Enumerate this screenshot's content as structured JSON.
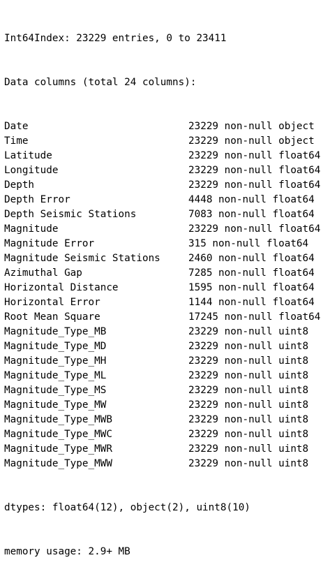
{
  "header": {
    "index_line": "Int64Index: 23229 entries, 0 to 23411",
    "columns_line": "Data columns (total 24 columns):"
  },
  "columns": [
    {
      "name": "Date",
      "info": "23229 non-null object"
    },
    {
      "name": "Time",
      "info": "23229 non-null object"
    },
    {
      "name": "Latitude",
      "info": "23229 non-null float64"
    },
    {
      "name": "Longitude",
      "info": "23229 non-null float64"
    },
    {
      "name": "Depth",
      "info": "23229 non-null float64"
    },
    {
      "name": "Depth Error",
      "info": "4448 non-null float64"
    },
    {
      "name": "Depth Seismic Stations",
      "info": "7083 non-null float64"
    },
    {
      "name": "Magnitude",
      "info": "23229 non-null float64"
    },
    {
      "name": "Magnitude Error",
      "info": "315 non-null float64"
    },
    {
      "name": "Magnitude Seismic Stations",
      "info": "2460 non-null float64"
    },
    {
      "name": "Azimuthal Gap",
      "info": "7285 non-null float64"
    },
    {
      "name": "Horizontal Distance",
      "info": "1595 non-null float64"
    },
    {
      "name": "Horizontal Error",
      "info": "1144 non-null float64"
    },
    {
      "name": "Root Mean Square",
      "info": "17245 non-null float64"
    },
    {
      "name": "Magnitude_Type_MB",
      "info": "23229 non-null uint8"
    },
    {
      "name": "Magnitude_Type_MD",
      "info": "23229 non-null uint8"
    },
    {
      "name": "Magnitude_Type_MH",
      "info": "23229 non-null uint8"
    },
    {
      "name": "Magnitude_Type_ML",
      "info": "23229 non-null uint8"
    },
    {
      "name": "Magnitude_Type_MS",
      "info": "23229 non-null uint8"
    },
    {
      "name": "Magnitude_Type_MW",
      "info": "23229 non-null uint8"
    },
    {
      "name": "Magnitude_Type_MWB",
      "info": "23229 non-null uint8"
    },
    {
      "name": "Magnitude_Type_MWC",
      "info": "23229 non-null uint8"
    },
    {
      "name": "Magnitude_Type_MWR",
      "info": "23229 non-null uint8"
    },
    {
      "name": "Magnitude_Type_MWW",
      "info": "23229 non-null uint8"
    }
  ],
  "footer": {
    "dtypes_line": "dtypes: float64(12), object(2), uint8(10)",
    "memory_line": "memory usage: 2.9+ MB"
  }
}
